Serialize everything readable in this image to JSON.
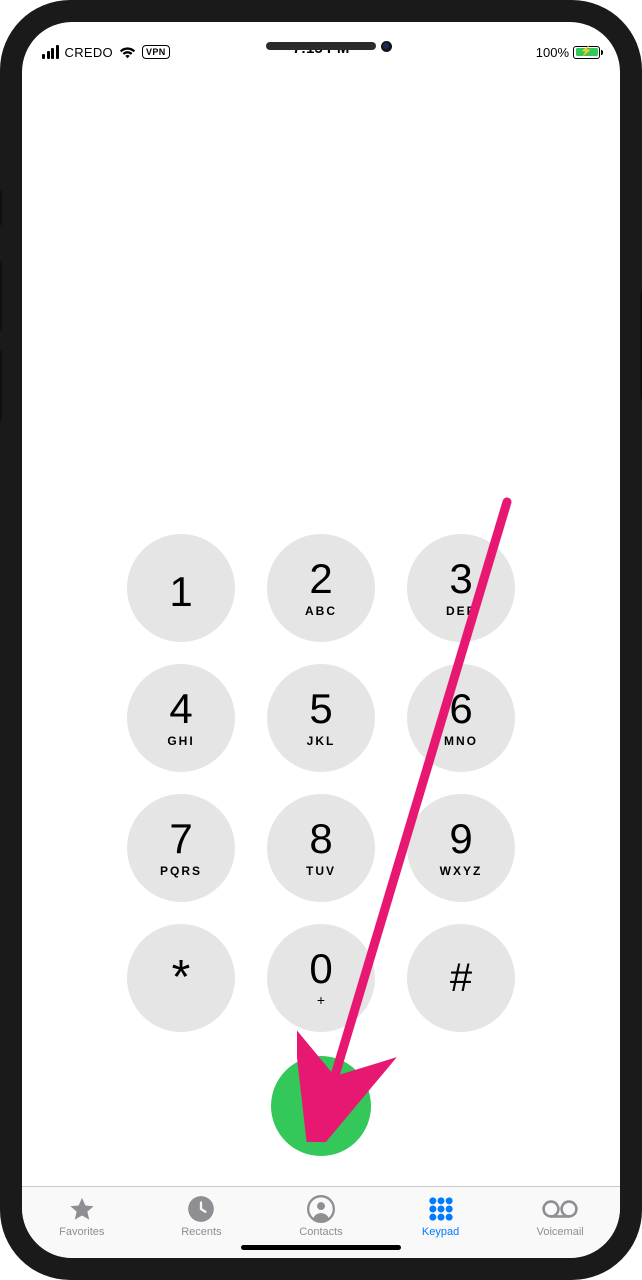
{
  "status": {
    "carrier": "CREDO",
    "vpn_label": "VPN",
    "time": "7:15 PM",
    "battery_pct": "100%"
  },
  "keypad": {
    "keys": [
      {
        "digit": "1",
        "letters": ""
      },
      {
        "digit": "2",
        "letters": "ABC"
      },
      {
        "digit": "3",
        "letters": "DEF"
      },
      {
        "digit": "4",
        "letters": "GHI"
      },
      {
        "digit": "5",
        "letters": "JKL"
      },
      {
        "digit": "6",
        "letters": "MNO"
      },
      {
        "digit": "7",
        "letters": "PQRS"
      },
      {
        "digit": "8",
        "letters": "TUV"
      },
      {
        "digit": "9",
        "letters": "WXYZ"
      },
      {
        "digit": "*",
        "letters": ""
      },
      {
        "digit": "0",
        "letters": "+"
      },
      {
        "digit": "#",
        "letters": ""
      }
    ]
  },
  "tabs": {
    "items": [
      {
        "id": "favorites",
        "label": "Favorites",
        "active": false
      },
      {
        "id": "recents",
        "label": "Recents",
        "active": false
      },
      {
        "id": "contacts",
        "label": "Contacts",
        "active": false
      },
      {
        "id": "keypad",
        "label": "Keypad",
        "active": true
      },
      {
        "id": "voicemail",
        "label": "Voicemail",
        "active": false
      }
    ]
  },
  "colors": {
    "accent": "#007aff",
    "call_green": "#34c759",
    "key_bg": "#e5e5e5",
    "tab_inactive": "#8e8e93",
    "annotation": "#e71872"
  }
}
